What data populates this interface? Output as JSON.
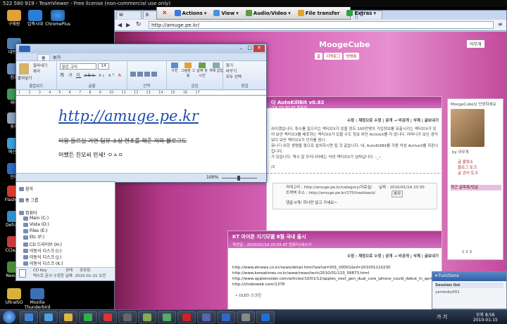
{
  "teamviewer": {
    "title": "522 580 919 - TeamViewer - Free license (non-commercial use only)",
    "actions": "Actions",
    "view": "View",
    "audio_video": "Audio/Video",
    "file_transfer": "File transfer",
    "extras": "Extras"
  },
  "desktop_icons": [
    {
      "label": "구해원"
    },
    {
      "label": "압축시대"
    },
    {
      "label": "ChromePlus"
    },
    {
      "label": "네트워"
    },
    {
      "label": "컴퓨"
    },
    {
      "label": "제어"
    },
    {
      "label": "휴지"
    },
    {
      "label": "에신처"
    },
    {
      "label": "인터"
    },
    {
      "label": "FlashGet"
    },
    {
      "label": "Defrago"
    },
    {
      "label": "CCleane"
    },
    {
      "label": "NexusFi"
    },
    {
      "label": "UltraISO"
    },
    {
      "label": "Mozilla Thunderbird"
    }
  ],
  "browser": {
    "url": "http://amuge.pe.kr/",
    "blog_title": "MoogeCube",
    "top_links": [
      "홈",
      "지역로그",
      "방명록"
    ],
    "user_menu": "아무개",
    "post1_title": "다 AutoKillBit v0.82",
    "post1_meta": "/14 23:30 KT 컴퓨터",
    "post1_actions": "수정 : 재정으로 수정 | 공개 → 비공개 | 삭제 | 글보내기",
    "post1_body": "쓰이겠습니다. 특수를 일으키는 액티브X가 있을 정도 100만명의 가입정보를 유출시키는 액티브X가 있어 보안 액티브X를 배포하는 액티브X가 있을 수도 정보 차단 ActiveX를 자 압니다. 어머니가 보신 생각보다 보안 액티브X가 인지를 점니.",
    "post1_body2": "뮤니디 위한 생명을 핑으로 설치하시면 됩 것 같습니다. 네, AutoKillBit를 각종 악성 ActiveX를 자판시킵니다.",
    "post1_body3": "가 있습니다. 역시 잘 우리나라에는 악성 액티브X가 넘쳐납니다. -_-;",
    "post1_tags": "/2",
    "trackback_category": "카테고리 : http://amuge.pe.kr/category/자료실/",
    "trackback_date": "날짜 : 2010/01/14 23:30",
    "trackback_addr": "트랙백 주소 : http://amuge.pe.kr/275/trackback/",
    "trackback_copy": "복사",
    "comment": "댓글 0개! 하나만 달고 가세요~",
    "post2_title": "KT 아이폰 지기모델 8월 국내 출시",
    "post2_meta": "작성일 - 2010/01/14 23:05 KT 컴퓨터/세소식",
    "post2_actions": "수정 : 재정으로 수정 | 공개 → 비공개 | 삭제 | 글보내기",
    "post2_links": [
      "http://www.etnews.co.kr/news/detail.html?portal=001_00001&id=201001110230",
      "http://www.koreatimes.co.kr/www/news/tech/2010/01/133_58873.html",
      "http://www.appleinsider.com/articles/10/01/12/apples_next_gen_dual_core_iphone_could_debut_in_april_report.html",
      "http://choboweb.com/1378"
    ],
    "post2_bullet": "OLED 스크린",
    "sidebar_profile": "MoogeCube님 안녕하세요",
    "sidebar_name": "by 아무개",
    "sidebar_links": [
      "글 올렸소",
      "블로그 토크",
      "글 관리 토크"
    ],
    "sidebar_box_title": "최근 글목록/댓글",
    "sidebar_count": "1 2 3"
  },
  "wordpad": {
    "tab_home": "홈",
    "tab_view": "보기",
    "paste": "붙여넣기",
    "cut": "잘라내기",
    "copy": "복사",
    "clipboard": "클립보드",
    "font_name": "맑은 고딕",
    "font_size": "14",
    "font_group": "글꼴",
    "paragraph": "단락",
    "insert_image": "사진",
    "insert_paint": "그림판 그림",
    "insert_datetime": "날짜 및 시간",
    "insert_object": "개체 삽입",
    "insert": "삽입",
    "find": "찾기",
    "replace": "바꾸기",
    "select_all": "모두 선택",
    "edit": "편집",
    "ruler": "· 1 · · · 2 · · · 3 · · · 4 · · · 5 · · · 6 · · · 7 · · · 8 · · · 9 · · · 10 · · · 11 · · · 12 · · · 13 · · · 14 · · · 15 · · · 16 · · · 17",
    "doc_link": "http://amuge.pe.kr",
    "doc_strike": "이왕 들르실 거면 팀뷰 소상 현조를 해준 저의 블로그도",
    "doc_line": "어쨌든 친모씨 만세! ㅇㅅㅇ",
    "zoom": "100%"
  },
  "explorer": {
    "items": [
      "음악",
      "홈 그룹",
      "컴퓨터",
      "Main (C:)",
      "Vista (D:)",
      "Files (E:)",
      "Etc (F:)",
      "CD 드라이브 (H:)",
      "이동식 디스크 (I:)",
      "이동식 디스크 (J:)",
      "이동식 디스크 (K:)"
    ],
    "file_name": "CD Key",
    "file_type": "텍스트 문서",
    "file_status_label": "상태",
    "file_status": "공유됨",
    "file_modified": "수정한 날짜: 2010-01-15 오전"
  },
  "chat": {
    "title": "Functions",
    "session": "Session list",
    "user": "yamtoby001"
  },
  "tray": {
    "lang": "가 기",
    "time": "오후 8:56",
    "date": "2010-01-15"
  }
}
